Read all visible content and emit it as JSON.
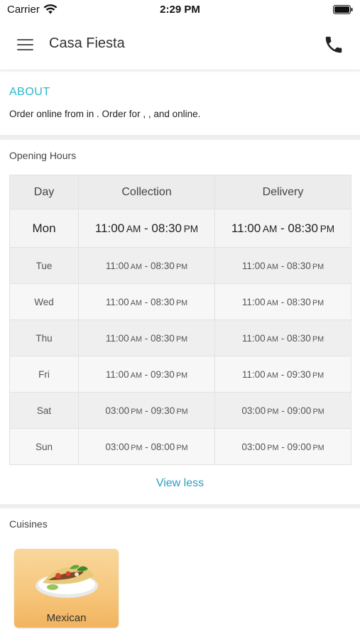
{
  "status_bar": {
    "carrier": "Carrier",
    "time": "2:29 PM"
  },
  "nav": {
    "title": "Casa Fiesta",
    "menu_icon": "hamburger-icon",
    "phone_icon": "phone-icon"
  },
  "about": {
    "title": "ABOUT",
    "text": "Order online from  in . Order for , ,  and  online."
  },
  "hours": {
    "title": "Opening Hours",
    "columns": [
      "Day",
      "Collection",
      "Delivery"
    ],
    "rows": [
      {
        "day": "Mon",
        "collection": {
          "from": "11:00",
          "from_ampm": "AM",
          "to": "08:30",
          "to_ampm": "PM"
        },
        "delivery": {
          "from": "11:00",
          "from_ampm": "AM",
          "to": "08:30",
          "to_ampm": "PM"
        }
      },
      {
        "day": "Tue",
        "collection": {
          "from": "11:00",
          "from_ampm": "AM",
          "to": "08:30",
          "to_ampm": "PM"
        },
        "delivery": {
          "from": "11:00",
          "from_ampm": "AM",
          "to": "08:30",
          "to_ampm": "PM"
        }
      },
      {
        "day": "Wed",
        "collection": {
          "from": "11:00",
          "from_ampm": "AM",
          "to": "08:30",
          "to_ampm": "PM"
        },
        "delivery": {
          "from": "11:00",
          "from_ampm": "AM",
          "to": "08:30",
          "to_ampm": "PM"
        }
      },
      {
        "day": "Thu",
        "collection": {
          "from": "11:00",
          "from_ampm": "AM",
          "to": "08:30",
          "to_ampm": "PM"
        },
        "delivery": {
          "from": "11:00",
          "from_ampm": "AM",
          "to": "08:30",
          "to_ampm": "PM"
        }
      },
      {
        "day": "Fri",
        "collection": {
          "from": "11:00",
          "from_ampm": "AM",
          "to": "09:30",
          "to_ampm": "PM"
        },
        "delivery": {
          "from": "11:00",
          "from_ampm": "AM",
          "to": "09:30",
          "to_ampm": "PM"
        }
      },
      {
        "day": "Sat",
        "collection": {
          "from": "03:00",
          "from_ampm": "PM",
          "to": "09:30",
          "to_ampm": "PM"
        },
        "delivery": {
          "from": "03:00",
          "from_ampm": "PM",
          "to": "09:00",
          "to_ampm": "PM"
        }
      },
      {
        "day": "Sun",
        "collection": {
          "from": "03:00",
          "from_ampm": "PM",
          "to": "08:00",
          "to_ampm": "PM"
        },
        "delivery": {
          "from": "03:00",
          "from_ampm": "PM",
          "to": "09:00",
          "to_ampm": "PM"
        }
      }
    ],
    "toggle_label": "View less"
  },
  "cuisines": {
    "title": "Cuisines",
    "items": [
      {
        "label": "Mexican",
        "icon": "taco-plate-image"
      }
    ]
  },
  "colors": {
    "accent": "#27b8c8",
    "link": "#2a9fc2",
    "card": "#f6c57a"
  }
}
